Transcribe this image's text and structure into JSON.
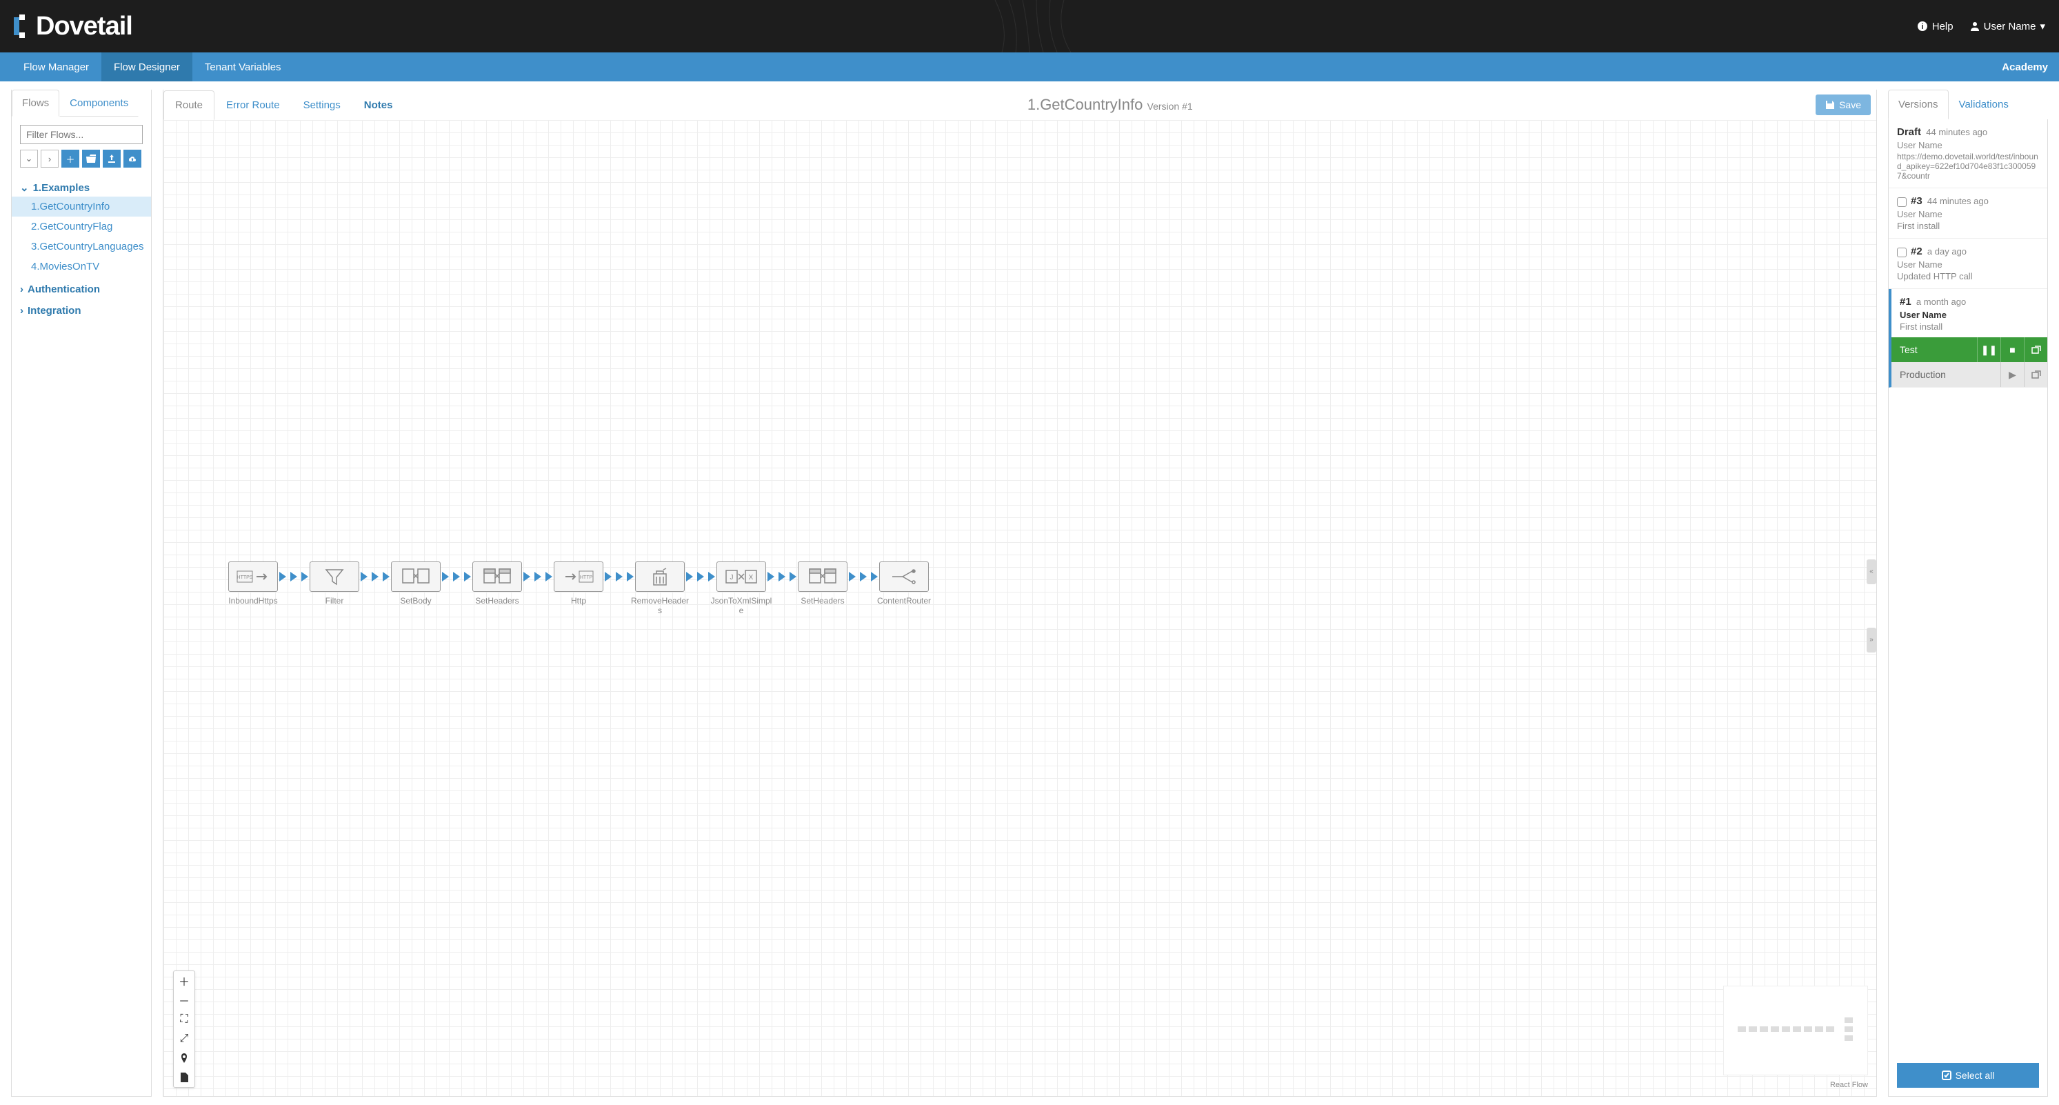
{
  "header": {
    "logo_text": "Dovetail",
    "help": "Help",
    "user": "User Name"
  },
  "nav": {
    "items": [
      "Flow Manager",
      "Flow Designer",
      "Tenant Variables"
    ],
    "active": 1,
    "right": "Academy"
  },
  "sidebar": {
    "tabs": [
      "Flows",
      "Components"
    ],
    "active": 0,
    "filter_placeholder": "Filter Flows...",
    "groups": [
      {
        "label": "1.Examples",
        "expanded": true,
        "items": [
          "1.GetCountryInfo",
          "2.GetCountryFlag",
          "3.GetCountryLanguages",
          "4.MoviesOnTV"
        ],
        "selected": 0
      },
      {
        "label": "Authentication",
        "expanded": false
      },
      {
        "label": "Integration",
        "expanded": false
      }
    ]
  },
  "canvas": {
    "tabs": [
      "Route",
      "Error Route",
      "Settings",
      "Notes"
    ],
    "active": 0,
    "title": "1.GetCountryInfo",
    "subtitle": "Version #1",
    "save": "Save",
    "nodes": [
      "InboundHttps",
      "Filter",
      "SetBody",
      "SetHeaders",
      "Http",
      "RemoveHeaders",
      "JsonToXmlSimple",
      "SetHeaders",
      "ContentRouter"
    ],
    "attr": "React Flow"
  },
  "right": {
    "tabs": [
      "Versions",
      "Validations"
    ],
    "active": 0,
    "draft": {
      "label": "Draft",
      "time": "44 minutes ago",
      "user": "User Name",
      "url": "https://demo.dovetail.world/test/inbound_apikey=622ef10d704e83f1c3000597&countr"
    },
    "versions": [
      {
        "num": "#3",
        "time": "44 minutes ago",
        "user": "User Name",
        "note": "First install"
      },
      {
        "num": "#2",
        "time": "a day ago",
        "user": "User Name",
        "note": "Updated HTTP call"
      },
      {
        "num": "#1",
        "time": "a month ago",
        "user": "User Name",
        "note": "First install",
        "selected": true
      }
    ],
    "envs": [
      {
        "name": "Test",
        "running": true
      },
      {
        "name": "Production",
        "running": false
      }
    ],
    "select_all": "Select all"
  }
}
